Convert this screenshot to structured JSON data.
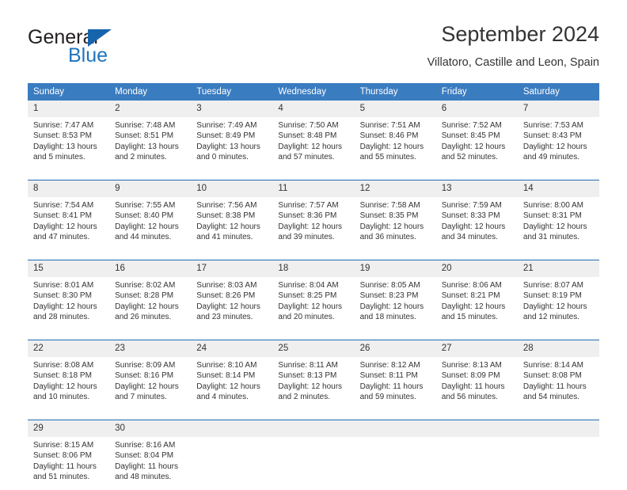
{
  "brand": {
    "name_part1": "General",
    "name_part2": "Blue",
    "logo_icon": "blue-triangle-icon"
  },
  "header": {
    "month_title": "September 2024",
    "location": "Villatoro, Castille and Leon, Spain"
  },
  "calendar": {
    "weekday_headers": [
      "Sunday",
      "Monday",
      "Tuesday",
      "Wednesday",
      "Thursday",
      "Friday",
      "Saturday"
    ],
    "accent_color": "#3a7cc0",
    "separator_color": "#1f6cb0",
    "daynum_band_color": "#efefef",
    "weeks": [
      [
        {
          "day": "1",
          "sunrise": "Sunrise: 7:47 AM",
          "sunset": "Sunset: 8:53 PM",
          "daylight_line1": "Daylight: 13 hours",
          "daylight_line2": "and 5 minutes."
        },
        {
          "day": "2",
          "sunrise": "Sunrise: 7:48 AM",
          "sunset": "Sunset: 8:51 PM",
          "daylight_line1": "Daylight: 13 hours",
          "daylight_line2": "and 2 minutes."
        },
        {
          "day": "3",
          "sunrise": "Sunrise: 7:49 AM",
          "sunset": "Sunset: 8:49 PM",
          "daylight_line1": "Daylight: 13 hours",
          "daylight_line2": "and 0 minutes."
        },
        {
          "day": "4",
          "sunrise": "Sunrise: 7:50 AM",
          "sunset": "Sunset: 8:48 PM",
          "daylight_line1": "Daylight: 12 hours",
          "daylight_line2": "and 57 minutes."
        },
        {
          "day": "5",
          "sunrise": "Sunrise: 7:51 AM",
          "sunset": "Sunset: 8:46 PM",
          "daylight_line1": "Daylight: 12 hours",
          "daylight_line2": "and 55 minutes."
        },
        {
          "day": "6",
          "sunrise": "Sunrise: 7:52 AM",
          "sunset": "Sunset: 8:45 PM",
          "daylight_line1": "Daylight: 12 hours",
          "daylight_line2": "and 52 minutes."
        },
        {
          "day": "7",
          "sunrise": "Sunrise: 7:53 AM",
          "sunset": "Sunset: 8:43 PM",
          "daylight_line1": "Daylight: 12 hours",
          "daylight_line2": "and 49 minutes."
        }
      ],
      [
        {
          "day": "8",
          "sunrise": "Sunrise: 7:54 AM",
          "sunset": "Sunset: 8:41 PM",
          "daylight_line1": "Daylight: 12 hours",
          "daylight_line2": "and 47 minutes."
        },
        {
          "day": "9",
          "sunrise": "Sunrise: 7:55 AM",
          "sunset": "Sunset: 8:40 PM",
          "daylight_line1": "Daylight: 12 hours",
          "daylight_line2": "and 44 minutes."
        },
        {
          "day": "10",
          "sunrise": "Sunrise: 7:56 AM",
          "sunset": "Sunset: 8:38 PM",
          "daylight_line1": "Daylight: 12 hours",
          "daylight_line2": "and 41 minutes."
        },
        {
          "day": "11",
          "sunrise": "Sunrise: 7:57 AM",
          "sunset": "Sunset: 8:36 PM",
          "daylight_line1": "Daylight: 12 hours",
          "daylight_line2": "and 39 minutes."
        },
        {
          "day": "12",
          "sunrise": "Sunrise: 7:58 AM",
          "sunset": "Sunset: 8:35 PM",
          "daylight_line1": "Daylight: 12 hours",
          "daylight_line2": "and 36 minutes."
        },
        {
          "day": "13",
          "sunrise": "Sunrise: 7:59 AM",
          "sunset": "Sunset: 8:33 PM",
          "daylight_line1": "Daylight: 12 hours",
          "daylight_line2": "and 34 minutes."
        },
        {
          "day": "14",
          "sunrise": "Sunrise: 8:00 AM",
          "sunset": "Sunset: 8:31 PM",
          "daylight_line1": "Daylight: 12 hours",
          "daylight_line2": "and 31 minutes."
        }
      ],
      [
        {
          "day": "15",
          "sunrise": "Sunrise: 8:01 AM",
          "sunset": "Sunset: 8:30 PM",
          "daylight_line1": "Daylight: 12 hours",
          "daylight_line2": "and 28 minutes."
        },
        {
          "day": "16",
          "sunrise": "Sunrise: 8:02 AM",
          "sunset": "Sunset: 8:28 PM",
          "daylight_line1": "Daylight: 12 hours",
          "daylight_line2": "and 26 minutes."
        },
        {
          "day": "17",
          "sunrise": "Sunrise: 8:03 AM",
          "sunset": "Sunset: 8:26 PM",
          "daylight_line1": "Daylight: 12 hours",
          "daylight_line2": "and 23 minutes."
        },
        {
          "day": "18",
          "sunrise": "Sunrise: 8:04 AM",
          "sunset": "Sunset: 8:25 PM",
          "daylight_line1": "Daylight: 12 hours",
          "daylight_line2": "and 20 minutes."
        },
        {
          "day": "19",
          "sunrise": "Sunrise: 8:05 AM",
          "sunset": "Sunset: 8:23 PM",
          "daylight_line1": "Daylight: 12 hours",
          "daylight_line2": "and 18 minutes."
        },
        {
          "day": "20",
          "sunrise": "Sunrise: 8:06 AM",
          "sunset": "Sunset: 8:21 PM",
          "daylight_line1": "Daylight: 12 hours",
          "daylight_line2": "and 15 minutes."
        },
        {
          "day": "21",
          "sunrise": "Sunrise: 8:07 AM",
          "sunset": "Sunset: 8:19 PM",
          "daylight_line1": "Daylight: 12 hours",
          "daylight_line2": "and 12 minutes."
        }
      ],
      [
        {
          "day": "22",
          "sunrise": "Sunrise: 8:08 AM",
          "sunset": "Sunset: 8:18 PM",
          "daylight_line1": "Daylight: 12 hours",
          "daylight_line2": "and 10 minutes."
        },
        {
          "day": "23",
          "sunrise": "Sunrise: 8:09 AM",
          "sunset": "Sunset: 8:16 PM",
          "daylight_line1": "Daylight: 12 hours",
          "daylight_line2": "and 7 minutes."
        },
        {
          "day": "24",
          "sunrise": "Sunrise: 8:10 AM",
          "sunset": "Sunset: 8:14 PM",
          "daylight_line1": "Daylight: 12 hours",
          "daylight_line2": "and 4 minutes."
        },
        {
          "day": "25",
          "sunrise": "Sunrise: 8:11 AM",
          "sunset": "Sunset: 8:13 PM",
          "daylight_line1": "Daylight: 12 hours",
          "daylight_line2": "and 2 minutes."
        },
        {
          "day": "26",
          "sunrise": "Sunrise: 8:12 AM",
          "sunset": "Sunset: 8:11 PM",
          "daylight_line1": "Daylight: 11 hours",
          "daylight_line2": "and 59 minutes."
        },
        {
          "day": "27",
          "sunrise": "Sunrise: 8:13 AM",
          "sunset": "Sunset: 8:09 PM",
          "daylight_line1": "Daylight: 11 hours",
          "daylight_line2": "and 56 minutes."
        },
        {
          "day": "28",
          "sunrise": "Sunrise: 8:14 AM",
          "sunset": "Sunset: 8:08 PM",
          "daylight_line1": "Daylight: 11 hours",
          "daylight_line2": "and 54 minutes."
        }
      ],
      [
        {
          "day": "29",
          "sunrise": "Sunrise: 8:15 AM",
          "sunset": "Sunset: 8:06 PM",
          "daylight_line1": "Daylight: 11 hours",
          "daylight_line2": "and 51 minutes."
        },
        {
          "day": "30",
          "sunrise": "Sunrise: 8:16 AM",
          "sunset": "Sunset: 8:04 PM",
          "daylight_line1": "Daylight: 11 hours",
          "daylight_line2": "and 48 minutes."
        },
        {
          "day": "",
          "sunrise": "",
          "sunset": "",
          "daylight_line1": "",
          "daylight_line2": ""
        },
        {
          "day": "",
          "sunrise": "",
          "sunset": "",
          "daylight_line1": "",
          "daylight_line2": ""
        },
        {
          "day": "",
          "sunrise": "",
          "sunset": "",
          "daylight_line1": "",
          "daylight_line2": ""
        },
        {
          "day": "",
          "sunrise": "",
          "sunset": "",
          "daylight_line1": "",
          "daylight_line2": ""
        },
        {
          "day": "",
          "sunrise": "",
          "sunset": "",
          "daylight_line1": "",
          "daylight_line2": ""
        }
      ]
    ]
  }
}
